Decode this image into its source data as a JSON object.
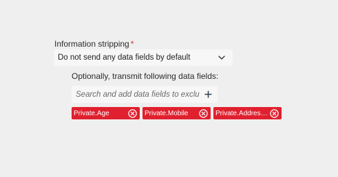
{
  "form": {
    "field_label": "Information stripping",
    "required_marker": "*",
    "select_value": "Do not send any data fields by default",
    "sub_label": "Optionally, transmit following data fields:",
    "search_placeholder": "Search and add data fields to exclude",
    "chips": [
      {
        "label": "Private.Age"
      },
      {
        "label": "Private.Mobile"
      },
      {
        "label": "Private.Addresse..."
      }
    ]
  },
  "colors": {
    "chip_background": "#e0202e",
    "required_star": "#d32f2f",
    "background": "#efefef"
  },
  "icons": {
    "select_chevron": "chevron-down-icon",
    "search_add": "plus-icon",
    "chip_remove": "close-circle-icon"
  }
}
